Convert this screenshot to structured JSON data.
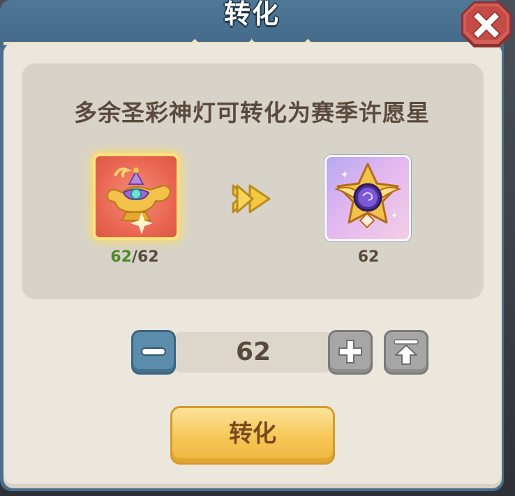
{
  "dialog": {
    "title": "转化",
    "description": "多余圣彩神灯可转化为赛季许愿星"
  },
  "source_item": {
    "icon": "magic-lamp-icon",
    "owned": "62",
    "separator": "/",
    "total": "62"
  },
  "target_item": {
    "icon": "wish-star-icon",
    "count": "62"
  },
  "quantity": {
    "value": "62"
  },
  "buttons": {
    "convert_label": "转化",
    "minus_icon": "minus-icon",
    "plus_icon": "plus-icon",
    "max_icon": "max-arrow-icon",
    "close_icon": "close-icon"
  },
  "colors": {
    "header": "#4f7796",
    "panel": "#ebe7dd",
    "owned_count": "#4f8a2a",
    "convert_button": "#f6c655",
    "close_button": "#c9534f"
  }
}
